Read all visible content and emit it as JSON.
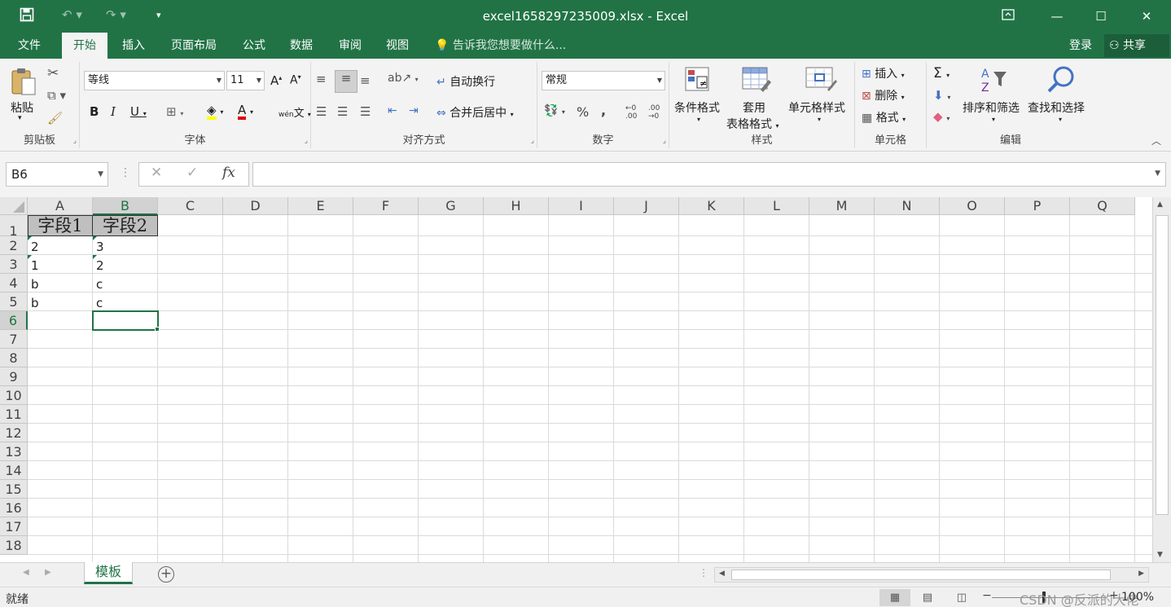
{
  "titlebar": {
    "title": "excel1658297235009.xlsx - Excel"
  },
  "tabs": {
    "items": [
      "文件",
      "开始",
      "插入",
      "页面布局",
      "公式",
      "数据",
      "审阅",
      "视图"
    ],
    "active": "开始",
    "tellme": "告诉我您想要做什么...",
    "login": "登录",
    "share": "共享"
  },
  "ribbon": {
    "clipboard": {
      "label": "剪贴板",
      "paste": "粘贴"
    },
    "font": {
      "label": "字体",
      "name": "等线",
      "size": "11",
      "phonetic": "wén"
    },
    "alignment": {
      "label": "对齐方式",
      "wrap": "自动换行",
      "merge": "合并后居中"
    },
    "number": {
      "label": "数字",
      "format": "常规"
    },
    "styles": {
      "label": "样式",
      "conditional": "条件格式",
      "table_line1": "套用",
      "table_line2": "表格格式",
      "cell_styles": "单元格样式"
    },
    "cells": {
      "label": "单元格",
      "insert": "插入",
      "delete": "删除",
      "format": "格式"
    },
    "editing": {
      "label": "编辑",
      "sort": "排序和筛选",
      "find": "查找和选择"
    }
  },
  "formula_bar": {
    "name_box": "B6",
    "fx": "fx",
    "content": ""
  },
  "sheet": {
    "columns": [
      "A",
      "B",
      "C",
      "D",
      "E",
      "F",
      "G",
      "H",
      "I",
      "J",
      "K",
      "L",
      "M",
      "N",
      "O",
      "P",
      "Q"
    ],
    "rows": [
      "1",
      "2",
      "3",
      "4",
      "5",
      "6",
      "7",
      "8",
      "9",
      "10",
      "11",
      "12",
      "13",
      "14",
      "15",
      "16",
      "17",
      "18"
    ],
    "selected_cell": "B6",
    "cells": {
      "A1": "字段1",
      "B1": "字段2",
      "A2": "2",
      "B2": "3",
      "A3": "1",
      "B3": "2",
      "A4": "b",
      "B4": "c",
      "A5": "b",
      "B5": "c"
    },
    "tab_name": "模板"
  },
  "statusbar": {
    "ready": "就绪",
    "zoom": "100%",
    "watermark": "CSDN @反派的大佬"
  },
  "colors": {
    "accent": "#217346",
    "header_fill": "#bfbfbf"
  }
}
